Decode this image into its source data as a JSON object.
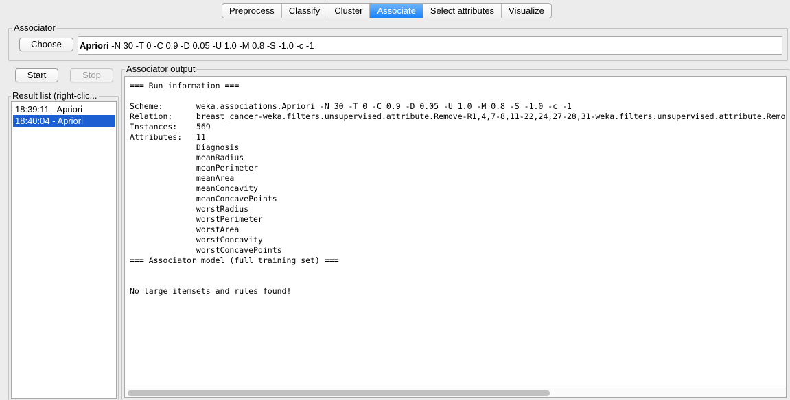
{
  "tabs": [
    {
      "label": "Preprocess"
    },
    {
      "label": "Classify"
    },
    {
      "label": "Cluster"
    },
    {
      "label": "Associate"
    },
    {
      "label": "Select attributes"
    },
    {
      "label": "Visualize"
    }
  ],
  "associator": {
    "legend": "Associator",
    "choose_label": "Choose",
    "scheme_name": "Apriori",
    "scheme_options": " -N 30 -T 0 -C 0.9 -D 0.05 -U 1.0 -M 0.8 -S -1.0 -c -1"
  },
  "controls": {
    "start_label": "Start",
    "stop_label": "Stop"
  },
  "result_list": {
    "legend": "Result list (right-clic...",
    "items": [
      "18:39:11 - Apriori",
      "18:40:04 - Apriori"
    ],
    "selected_index": 1
  },
  "output": {
    "legend": "Associator output",
    "text": "=== Run information ===\n\nScheme:       weka.associations.Apriori -N 30 -T 0 -C 0.9 -D 0.05 -U 1.0 -M 0.8 -S -1.0 -c -1\nRelation:     breast_cancer-weka.filters.unsupervised.attribute.Remove-R1,4,7-8,11-22,24,27-28,31-weka.filters.unsupervised.attribute.Remove\nInstances:    569\nAttributes:   11\n              Diagnosis\n              meanRadius\n              meanPerimeter\n              meanArea\n              meanConcavity\n              meanConcavePoints\n              worstRadius\n              worstPerimeter\n              worstArea\n              worstConcavity\n              worstConcavePoints\n=== Associator model (full training set) ===\n\n\nNo large itemsets and rules found!"
  },
  "colors": {
    "accent": "#1a82fb",
    "selection": "#1b5fd3"
  }
}
